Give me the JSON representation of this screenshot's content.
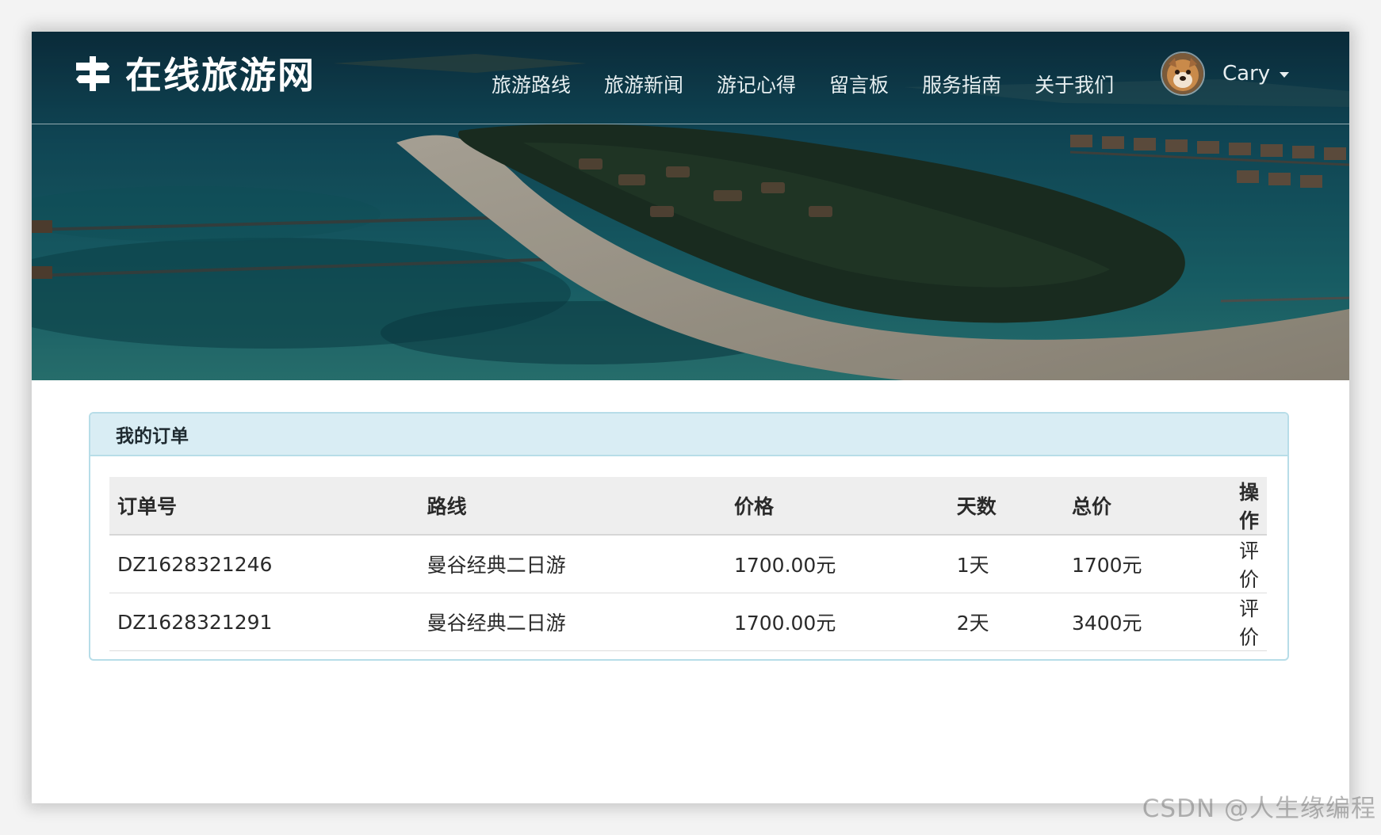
{
  "brand": {
    "title": "在线旅游网"
  },
  "nav": {
    "items": [
      {
        "label": "旅游路线"
      },
      {
        "label": "旅游新闻"
      },
      {
        "label": "游记心得"
      },
      {
        "label": "留言板"
      },
      {
        "label": "服务指南"
      },
      {
        "label": "关于我们"
      }
    ],
    "user": {
      "name": "Cary"
    }
  },
  "panel": {
    "heading": "我的订单",
    "table": {
      "headers": {
        "order_id": "订单号",
        "route": "路线",
        "price": "价格",
        "days": "天数",
        "total": "总价",
        "action": "操作"
      },
      "rows": [
        {
          "order_id": "DZ1628321246",
          "route": "曼谷经典二日游",
          "price": "1700.00元",
          "days": "1天",
          "total": "1700元",
          "action": "评价"
        },
        {
          "order_id": "DZ1628321291",
          "route": "曼谷经典二日游",
          "price": "1700.00元",
          "days": "2天",
          "total": "3400元",
          "action": "评价"
        }
      ]
    }
  },
  "watermark": "CSDN @人生缘编程",
  "colors": {
    "panel_border": "#b7dde8",
    "panel_heading_bg": "#d9edf4",
    "table_header_bg": "#eeeeee"
  }
}
